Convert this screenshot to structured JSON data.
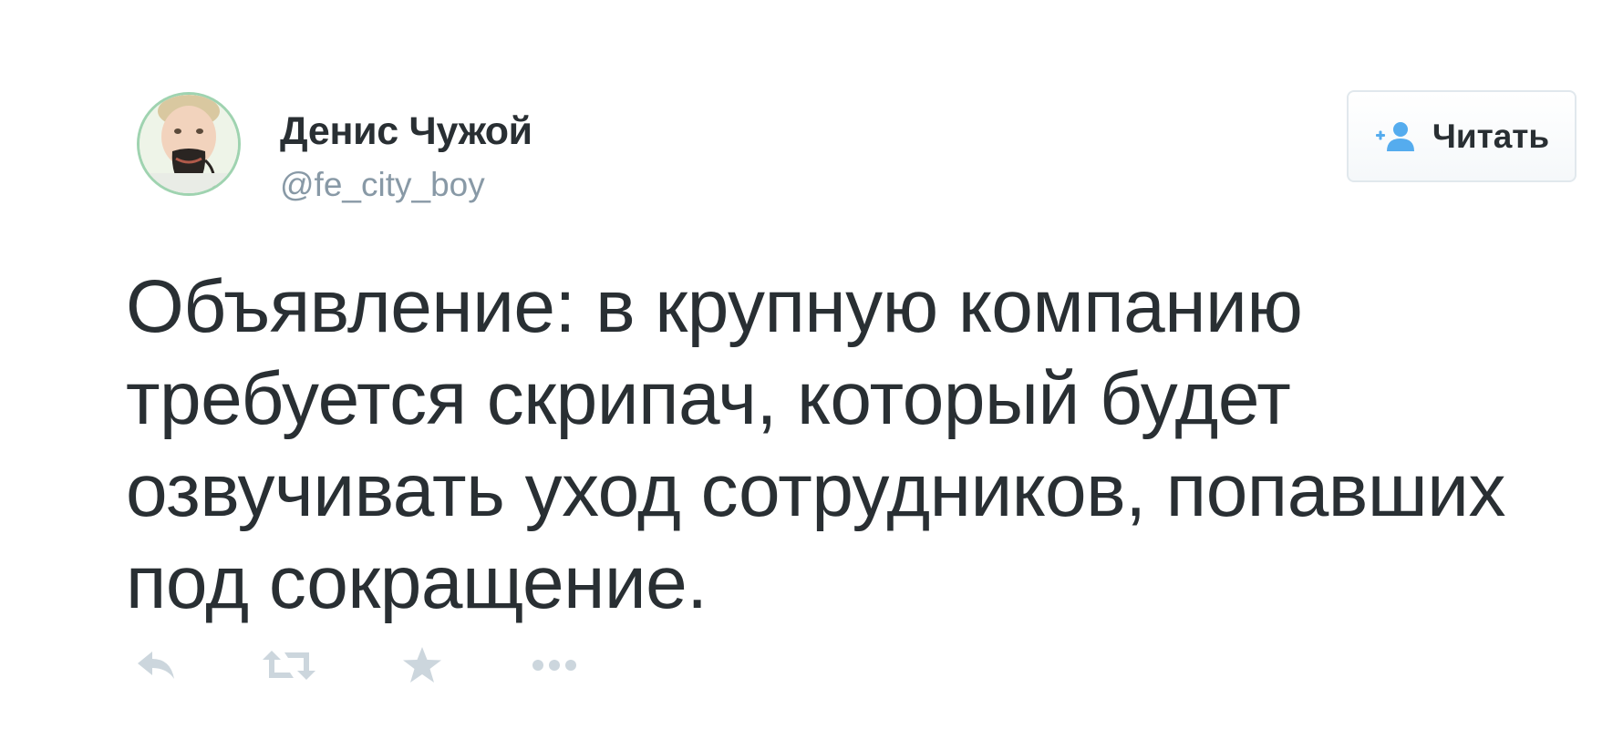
{
  "author": {
    "name": "Денис Чужой",
    "handle": "@fe_city_boy",
    "avatar_icon": "user-photo-icon"
  },
  "follow_button": {
    "label": "Читать",
    "icon": "add-user-icon"
  },
  "tweet": {
    "lines": [
      "Объявление: в крупную компанию",
      "требуется скрипач, который будет",
      "озвучивать уход сотрудников, попавших",
      "под сокращение."
    ]
  },
  "actions": [
    {
      "icon": "reply-icon"
    },
    {
      "icon": "retweet-icon"
    },
    {
      "icon": "favorite-star-icon"
    },
    {
      "icon": "more-dots-icon"
    }
  ],
  "colors": {
    "text": "#292f33",
    "muted": "#8899a6",
    "action_icons": "#ccd6dd",
    "follow_icon": "#55acee",
    "button_border": "#e1e8ed"
  }
}
